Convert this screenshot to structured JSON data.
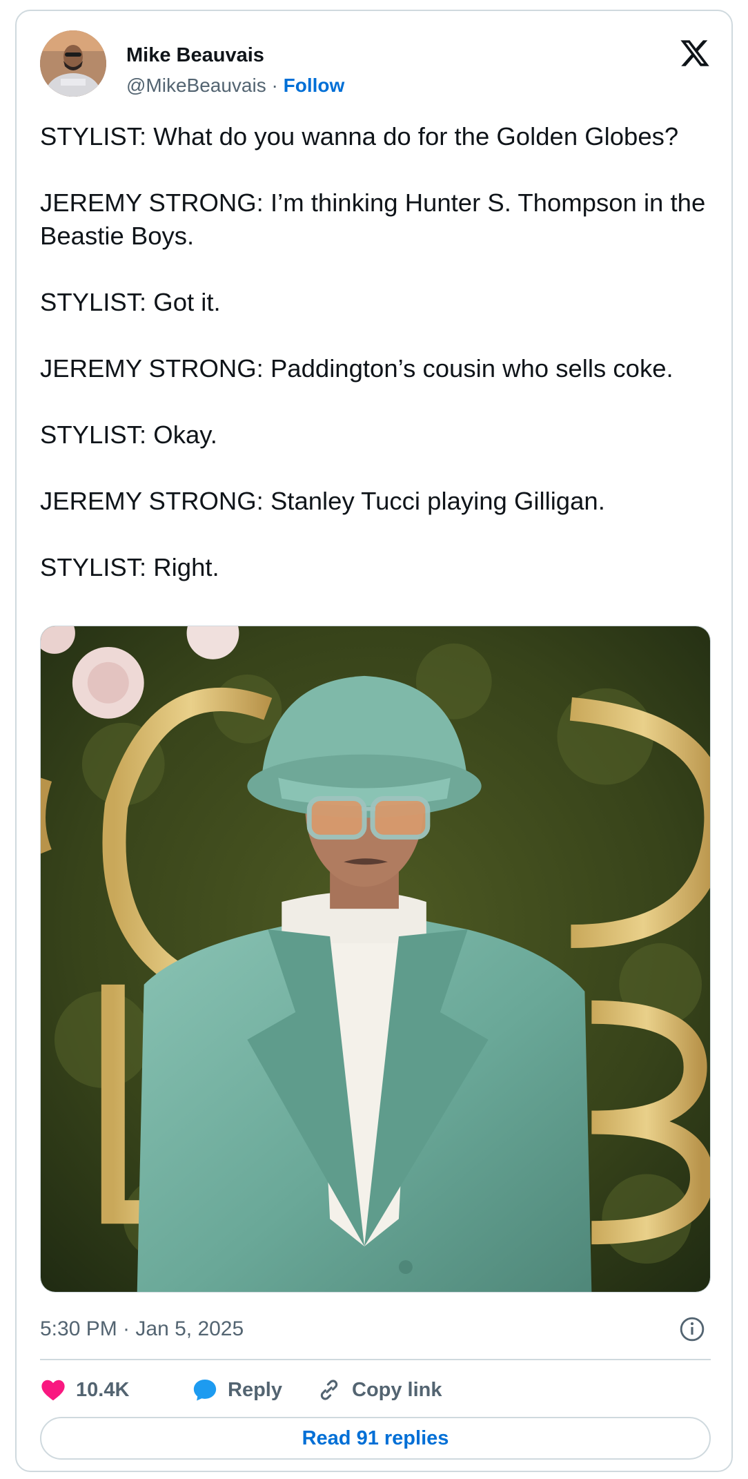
{
  "author": {
    "name": "Mike Beauvais",
    "handle": "@MikeBeauvais",
    "separator": "·",
    "follow_label": "Follow"
  },
  "tweet": {
    "paragraphs": [
      "STYLIST: What do you wanna do for the Golden Globes?",
      "JEREMY STRONG: I’m thinking Hunter S. Thompson in the Beastie Boys.",
      "STYLIST: Got it.",
      "JEREMY STRONG: Paddington’s cousin who sells coke.",
      "STYLIST: Okay.",
      "JEREMY STRONG: Stanley Tucci playing Gilligan.",
      "STYLIST: Right."
    ],
    "timestamp": "5:30 PM · Jan 5, 2025"
  },
  "photo": {
    "backdrop_letters": [
      "G",
      "O",
      "L",
      "D",
      "L",
      "B"
    ]
  },
  "actions": {
    "like_count": "10.4K",
    "reply_label": "Reply",
    "copy_label": "Copy link",
    "read_replies_label": "Read 91 replies"
  },
  "icons": {
    "platform": "x-logo-icon",
    "like": "heart-icon",
    "reply": "speech-bubble-icon",
    "copy": "link-icon",
    "info": "info-icon"
  },
  "colors": {
    "accent": "#006fd6",
    "like": "#f91880",
    "reply": "#1d9bf0",
    "muted": "#536471",
    "border": "#cfd9de"
  }
}
